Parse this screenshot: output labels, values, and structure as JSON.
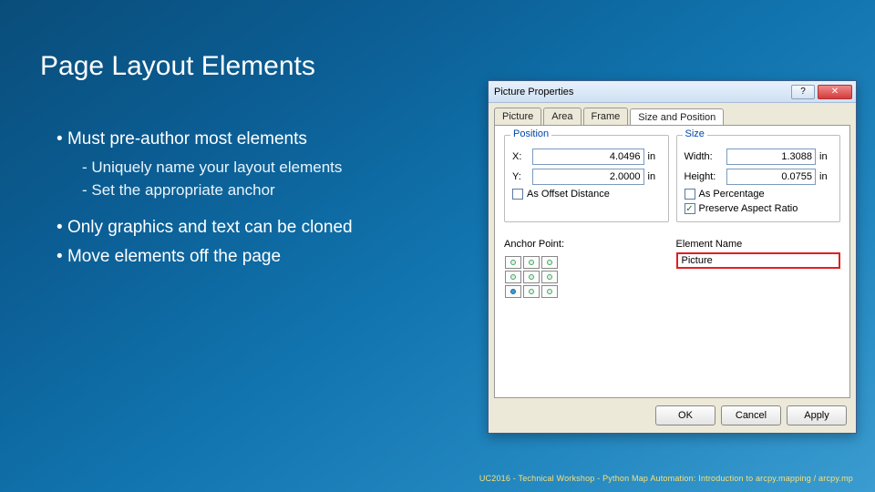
{
  "slide": {
    "title": "Page Layout Elements",
    "bullets": {
      "b1": "Must pre-author most elements",
      "s1": "Uniquely name your layout elements",
      "s2": "Set the appropriate anchor",
      "b2": "Only graphics and text can be cloned",
      "b3": "Move elements off the page"
    },
    "footer": "UC2016 - Technical Workshop - Python Map Automation: Introduction to arcpy.mapping / arcpy.mp"
  },
  "dialog": {
    "title": "Picture Properties",
    "help_icon": "?",
    "close_icon": "✕",
    "tabs": [
      "Picture",
      "Area",
      "Frame",
      "Size and Position"
    ],
    "active_tab": "Size and Position",
    "position": {
      "label": "Position",
      "x_label": "X:",
      "x_value": "4.0496",
      "x_unit": "in",
      "y_label": "Y:",
      "y_value": "2.0000",
      "y_unit": "in",
      "offset_label": "As Offset Distance",
      "offset_checked": false
    },
    "size": {
      "label": "Size",
      "w_label": "Width:",
      "w_value": "1.3088",
      "w_unit": "in",
      "h_label": "Height:",
      "h_value": "0.0755",
      "h_unit": "in",
      "pct_label": "As Percentage",
      "pct_checked": false,
      "aspect_label": "Preserve Aspect Ratio",
      "aspect_checked": true
    },
    "anchor": {
      "label": "Anchor Point:"
    },
    "element_name": {
      "label": "Element Name",
      "value": "Picture"
    },
    "buttons": {
      "ok": "OK",
      "cancel": "Cancel",
      "apply": "Apply"
    }
  }
}
